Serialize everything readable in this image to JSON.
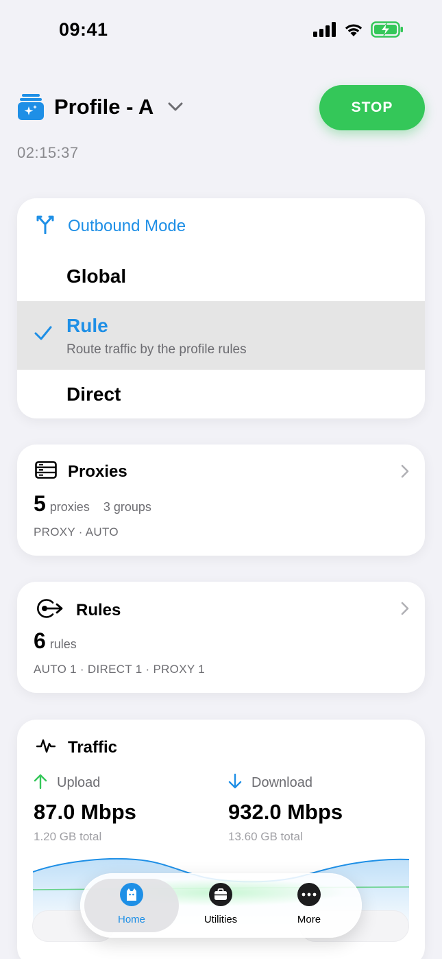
{
  "status_bar": {
    "time": "09:41"
  },
  "header": {
    "profile_name": "Profile - A",
    "elapsed": "02:15:37",
    "stop_label": "STOP"
  },
  "outbound_mode": {
    "title": "Outbound Mode",
    "options": [
      {
        "label": "Global"
      },
      {
        "label": "Rule",
        "description": "Route traffic by the profile rules",
        "selected": true
      },
      {
        "label": "Direct"
      }
    ]
  },
  "proxies": {
    "title": "Proxies",
    "count": "5",
    "unit": "proxies",
    "groups": "3 groups",
    "meta": "PROXY · AUTO"
  },
  "rules": {
    "title": "Rules",
    "count": "6",
    "unit": "rules",
    "meta": "AUTO 1 · DIRECT 1 · PROXY 1"
  },
  "traffic": {
    "title": "Traffic",
    "upload": {
      "label": "Upload",
      "value": "87.0 Mbps",
      "total": "1.20 GB total"
    },
    "download": {
      "label": "Download",
      "value": "932.0 Mbps",
      "total": "13.60 GB total"
    }
  },
  "tab_bar": {
    "tabs": [
      {
        "label": "Home",
        "active": true
      },
      {
        "label": "Utilities"
      },
      {
        "label": "More"
      }
    ]
  },
  "colors": {
    "accent": "#1e8fe6",
    "stop": "#34c759",
    "upload": "#34c759",
    "download": "#1e8fe6"
  }
}
